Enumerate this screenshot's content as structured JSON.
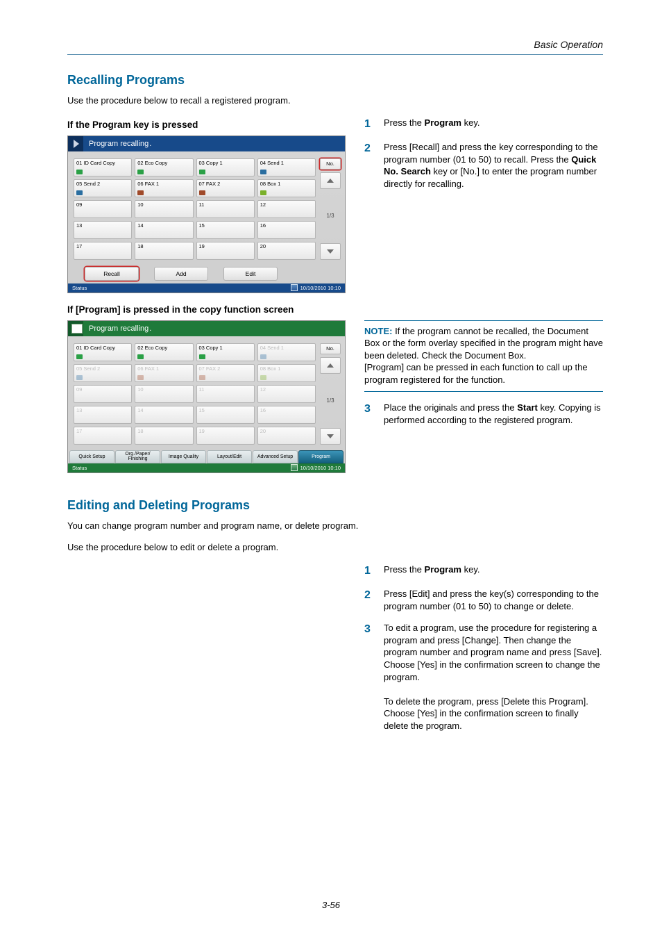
{
  "running_head": "Basic Operation",
  "section1_title": "Recalling Programs",
  "intro1": "Use the procedure below to recall a registered program.",
  "sub_if_key": "If the Program key is pressed",
  "sub_if_copy": "If [Program] is pressed in the copy function screen",
  "step1_text_a": "Press the ",
  "step1_bold": "Program",
  "step1_text_b": " key.",
  "step2_text_a": "Press [Recall] and press the key corresponding to the program number (01 to 50) to recall. Press the ",
  "step2_bold": "Quick No. Search",
  "step2_text_b": " key or [No.] to enter the program number directly for recalling.",
  "note_label": "NOTE:",
  "note_body1": " If the program cannot be recalled, the Document Box or the form overlay specified in the program might have been deleted. Check the Document Box.",
  "note_body2": "[Program] can be pressed in each function to call up the program registered for the function.",
  "step3_text_a": "Place the originals and press the ",
  "step3_bold": "Start",
  "step3_text_b": " key. Copying is performed according to the registered program.",
  "section2_title": "Editing and Deleting Programs",
  "intro2a": "You can change program number and program name, or delete program.",
  "intro2b": "Use the procedure below to edit or delete a program.",
  "b_step1_a": "Press the ",
  "b_step1_bold": "Program",
  "b_step1_b": " key.",
  "b_step2": "Press [Edit] and press the key(s) corresponding to the program number (01 to 50) to change or delete.",
  "b_step3_p1": "To edit a program, use the procedure for registering a program and press [Change]. Then change the program number and program name and press [Save]. Choose [Yes] in the confirmation screen to change the program.",
  "b_step3_p2": "To delete the program, press [Delete this Program]. Choose [Yes] in the confirmation screen to finally delete the program.",
  "page_num": "3-56",
  "ss": {
    "title": "Program recalling",
    "dot": ".",
    "no_btn": "No.",
    "page_label": "1/3",
    "recall": "Recall",
    "add": "Add",
    "edit": "Edit",
    "status": "Status",
    "timestamp": "10/10/2010   10:10",
    "cells_row1": [
      "01 ID Card Copy",
      "02 Eco Copy",
      "03 Copy 1",
      "04 Send 1"
    ],
    "cells_row2": [
      "05 Send 2",
      "06 FAX 1",
      "07 FAX 2",
      "08 Box 1"
    ],
    "cells_r3": [
      "09",
      "10",
      "11",
      "12"
    ],
    "cells_r4": [
      "13",
      "14",
      "15",
      "16"
    ],
    "cells_r5": [
      "17",
      "18",
      "19",
      "20"
    ],
    "func_tabs": [
      "Quick Setup",
      "Org./Paper/\nFinishing",
      "Image Quality",
      "Layout/Edit",
      "Advanced\nSetup",
      "Program"
    ]
  }
}
